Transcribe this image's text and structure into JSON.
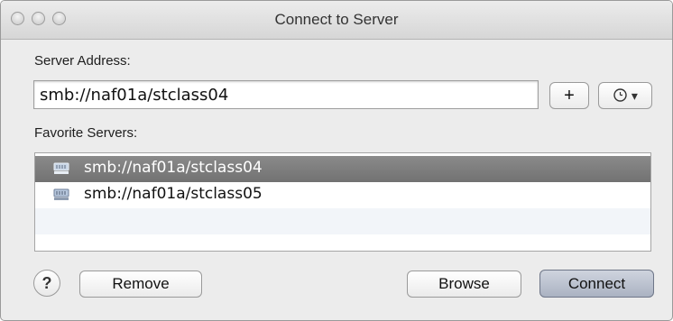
{
  "window": {
    "title": "Connect to Server"
  },
  "server_address": {
    "label": "Server Address:",
    "value": "smb://naf01a/stclass04"
  },
  "buttons": {
    "add": "+",
    "recent_arrow": "▾",
    "help": "?",
    "remove": "Remove",
    "browse": "Browse",
    "connect": "Connect"
  },
  "favorites": {
    "label": "Favorite Servers:",
    "items": [
      {
        "label": "smb://naf01a/stclass04",
        "selected": true
      },
      {
        "label": "smb://naf01a/stclass05",
        "selected": false
      }
    ]
  },
  "icons": {
    "traffic_lights": [
      "close-icon",
      "minimize-icon",
      "zoom-icon"
    ],
    "server_item": "network-server-icon",
    "recent": "clock-icon"
  }
}
